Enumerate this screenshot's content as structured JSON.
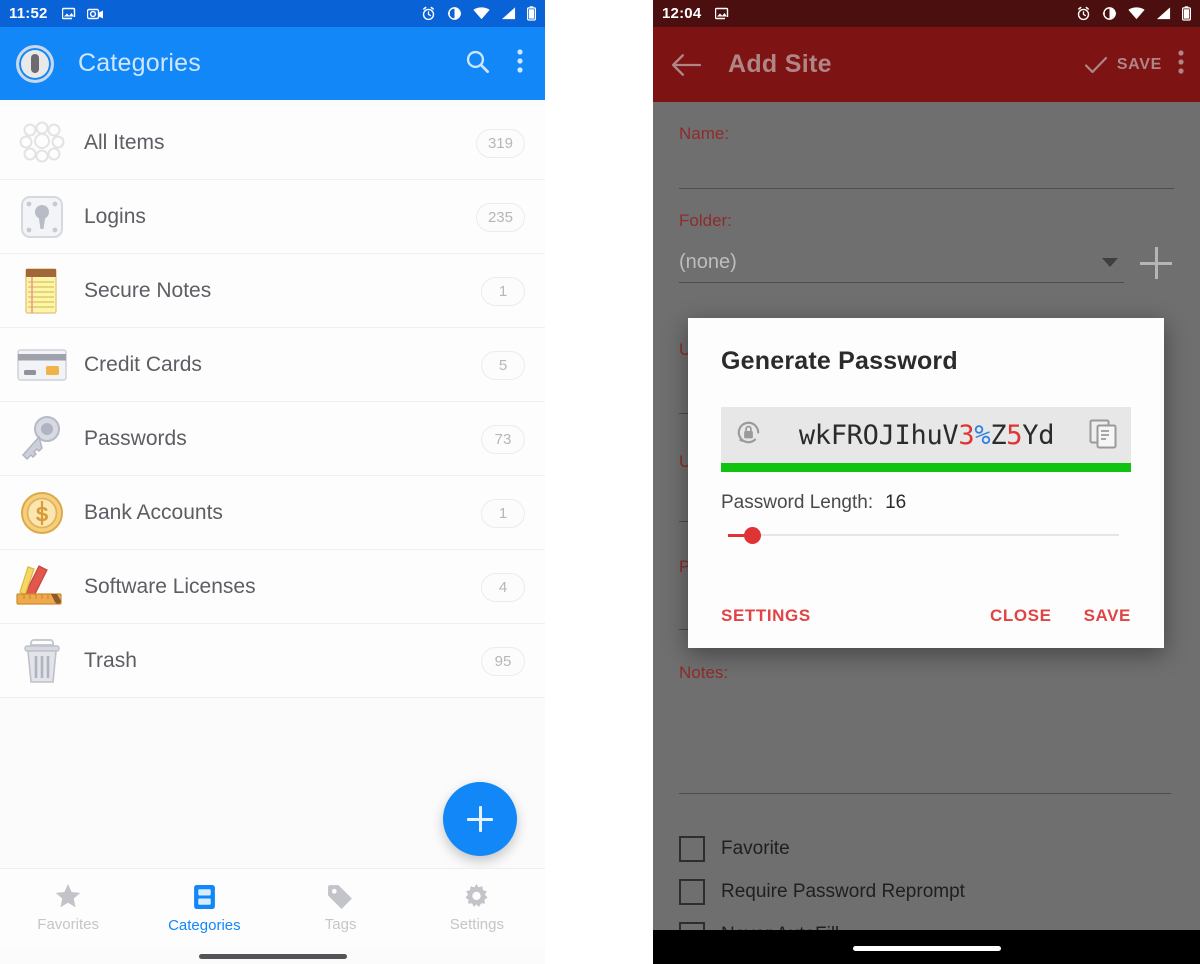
{
  "left_phone": {
    "status_bar": {
      "time": "11:52",
      "left_icons": [
        "image-icon",
        "screenshot-icon"
      ],
      "right_icons": [
        "alarm-icon",
        "brightness-icon",
        "wifi-icon",
        "signal-icon",
        "battery-icon"
      ]
    },
    "app_bar": {
      "title": "Categories",
      "logo": "vault-pin-icon",
      "search_icon": "search-icon",
      "overflow_icon": "more-vertical-icon"
    },
    "categories": [
      {
        "label": "All Items",
        "count": "319",
        "icon": "all-items-icon"
      },
      {
        "label": "Logins",
        "count": "235",
        "icon": "login-keyhole-icon"
      },
      {
        "label": "Secure Notes",
        "count": "1",
        "icon": "notepad-icon"
      },
      {
        "label": "Credit Cards",
        "count": "5",
        "icon": "credit-card-icon"
      },
      {
        "label": "Passwords",
        "count": "73",
        "icon": "key-icon"
      },
      {
        "label": "Bank Accounts",
        "count": "1",
        "icon": "coin-dollar-icon"
      },
      {
        "label": "Software Licenses",
        "count": "4",
        "icon": "ruler-pencil-brush-icon"
      },
      {
        "label": "Trash",
        "count": "95",
        "icon": "trash-icon"
      }
    ],
    "fab": {
      "icon": "plus-icon",
      "color": "#1287f7"
    },
    "bottom_nav": [
      {
        "label": "Favorites",
        "icon": "star-icon",
        "active": false
      },
      {
        "label": "Categories",
        "icon": "vault-icon",
        "active": true
      },
      {
        "label": "Tags",
        "icon": "tag-icon",
        "active": false
      },
      {
        "label": "Settings",
        "icon": "gear-icon",
        "active": false
      }
    ],
    "accent_color": "#1287f7"
  },
  "right_phone": {
    "status_bar": {
      "time": "12:04",
      "left_icons": [
        "image-icon"
      ],
      "right_icons": [
        "alarm-icon",
        "brightness-icon",
        "wifi-icon",
        "signal-icon",
        "battery-icon"
      ]
    },
    "app_bar": {
      "back_icon": "arrow-left-icon",
      "title": "Add Site",
      "save_label": "SAVE",
      "save_icon": "check-icon",
      "overflow_icon": "more-vertical-icon"
    },
    "form": {
      "name_label": "Name:",
      "name_value": "",
      "folder_label": "Folder:",
      "folder_value": "(none)",
      "folder_caret": "chevron-down-icon",
      "add_folder_icon": "plus-icon",
      "obscured_labels": [
        "U",
        "U",
        "P"
      ],
      "notes_label": "Notes:",
      "notes_value": ""
    },
    "checkboxes": [
      {
        "label": "Favorite",
        "checked": false
      },
      {
        "label": "Require Password Reprompt",
        "checked": false
      },
      {
        "label": "Never AutoFill",
        "checked": false
      }
    ],
    "accent_color": "#7d1313"
  },
  "dialog": {
    "title": "Generate Password",
    "regenerate_icon": "lock-refresh-icon",
    "copy_icon": "copy-icon",
    "password": {
      "full": "wkFROJIhuV3%Z5Yd",
      "segments": [
        {
          "text": "wkFROJIhuV",
          "kind": "letter"
        },
        {
          "text": "3",
          "kind": "digit"
        },
        {
          "text": "%",
          "kind": "symbol"
        },
        {
          "text": "Z",
          "kind": "letter"
        },
        {
          "text": "5",
          "kind": "digit"
        },
        {
          "text": "Yd",
          "kind": "letter"
        }
      ]
    },
    "strength": {
      "label": "strong",
      "color": "#11c311",
      "percent": 100
    },
    "length_label": "Password Length:",
    "length_value": "16",
    "slider": {
      "value": 16,
      "percent": 4
    },
    "buttons": {
      "settings": "SETTINGS",
      "close": "CLOSE",
      "save": "SAVE"
    },
    "accent_color": "#e04444"
  }
}
